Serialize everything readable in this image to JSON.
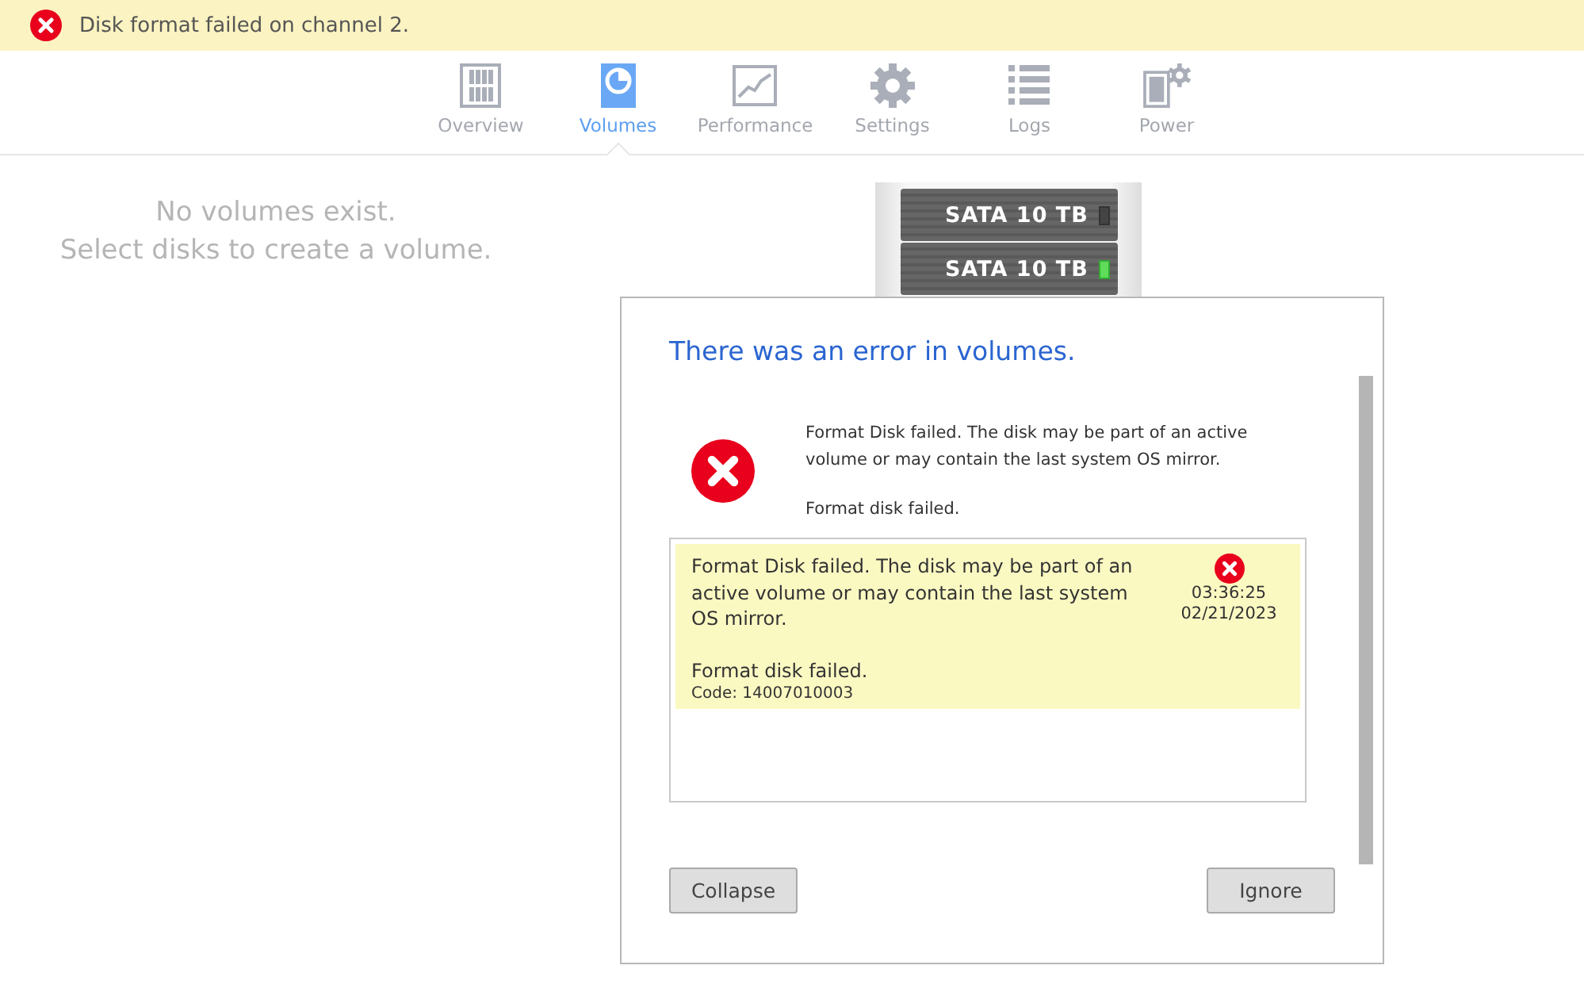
{
  "banner": {
    "message": "Disk format failed on channel 2."
  },
  "nav": [
    {
      "label": "Overview",
      "kind": "overview",
      "selected": false
    },
    {
      "label": "Volumes",
      "kind": "volumes",
      "selected": true
    },
    {
      "label": "Performance",
      "kind": "performance",
      "selected": false
    },
    {
      "label": "Settings",
      "kind": "settings",
      "selected": false
    },
    {
      "label": "Logs",
      "kind": "logs",
      "selected": false
    },
    {
      "label": "Power",
      "kind": "power",
      "selected": false
    }
  ],
  "empty_message": [
    "No volumes exist.",
    "Select disks to create a volume."
  ],
  "enclosure": {
    "drives": [
      {
        "label": "SATA 10 TB",
        "led_on": false
      },
      {
        "label": "SATA 10 TB",
        "led_on": true
      }
    ]
  },
  "dialog": {
    "title": "There was an error in volumes.",
    "summary": "Format Disk failed. The disk may be part of an active volume or may contain the last system OS mirror.",
    "detail": "Format disk failed.",
    "log": [
      {
        "message": "Format Disk failed. The disk may be part of an active volume or may contain the last system OS mirror.",
        "detail": "Format disk failed.",
        "code": "Code: 14007010003",
        "time": "03:36:25",
        "date": "02/21/2023"
      }
    ],
    "buttons": [
      "Collapse",
      "Ignore"
    ]
  }
}
